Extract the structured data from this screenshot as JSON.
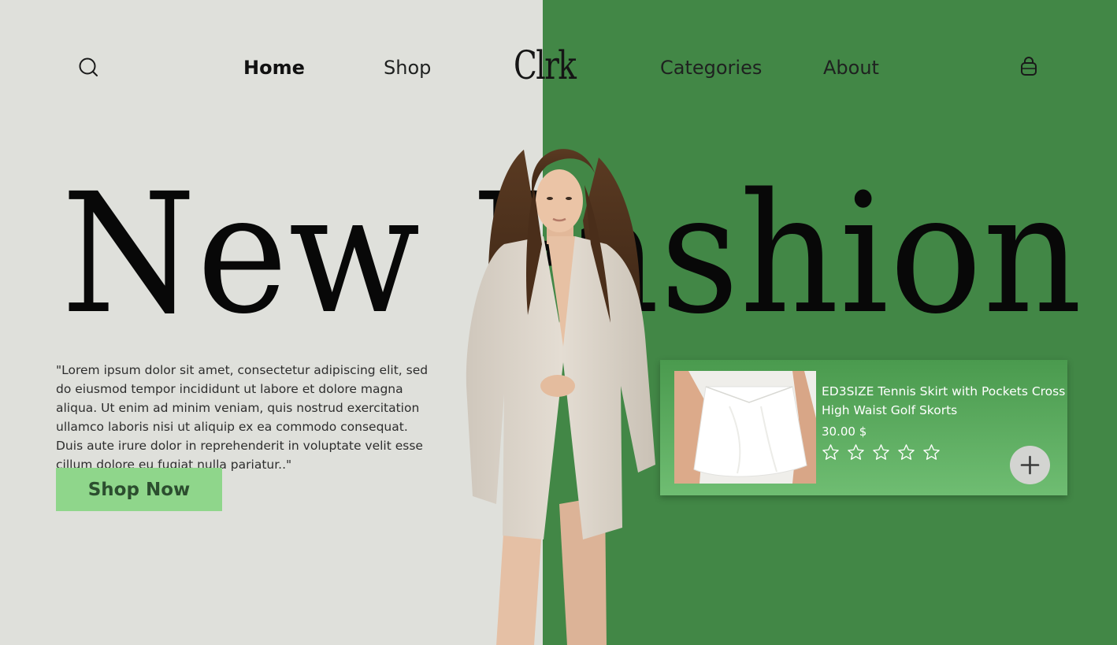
{
  "brand": {
    "logo_text": "Clrk"
  },
  "nav": {
    "items": [
      {
        "label": "Home",
        "active": true
      },
      {
        "label": "Shop",
        "active": false
      },
      {
        "label": "Categories",
        "active": false
      },
      {
        "label": "About",
        "active": false
      }
    ],
    "search_icon": "search-icon",
    "cart_icon": "shopping-bag-icon"
  },
  "hero": {
    "title": "New Fashion",
    "description": "\"Lorem ipsum dolor sit amet, consectetur adipiscing elit, sed do eiusmod tempor incididunt ut labore et dolore magna aliqua. Ut enim ad minim veniam, quis nostrud exercitation ullamco laboris nisi ut aliquip ex ea commodo consequat. Duis aute irure dolor in reprehenderit in voluptate velit esse cillum dolore eu fugiat nulla pariatur..\"",
    "cta_label": "Shop Now"
  },
  "product": {
    "title": "ED3SIZE Tennis Skirt with Pockets Cross High Waist Golf Skorts",
    "price": "30.00 $",
    "rating": {
      "stars": 5,
      "filled": 0
    },
    "add_icon": "plus-icon"
  },
  "colors": {
    "left_background": "#dfe0db",
    "right_background": "#428746",
    "cta_background": "#8fd68b",
    "card_gradient_top": "#4a9a4e",
    "card_gradient_bottom": "#6fbd72"
  }
}
